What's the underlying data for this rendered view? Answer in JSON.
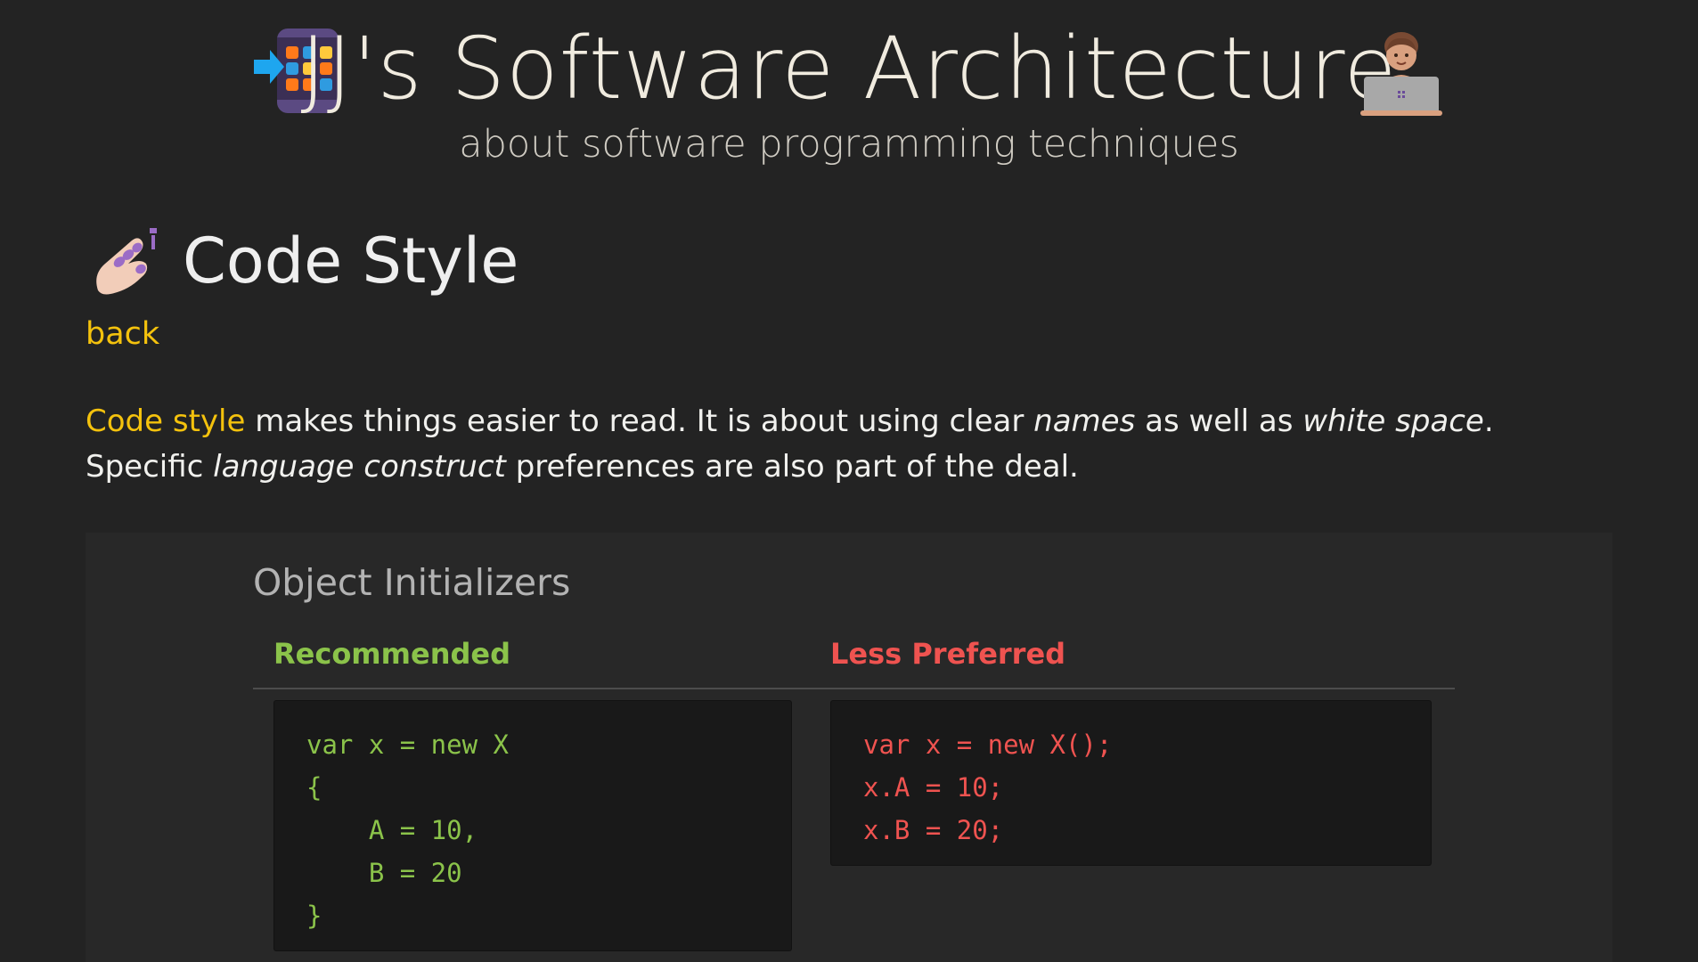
{
  "header": {
    "title": "JJ's Software Architecture",
    "subtitle": "about software programming techniques",
    "logo_icon": "app-grid-enter-icon",
    "developer_icon": "technologist-laptop-icon"
  },
  "article": {
    "section_icon": "nail-polish-icon",
    "title": "Code Style",
    "back_label": "back",
    "intro": {
      "term": "Code style",
      "part1": " makes things easier to read. It is about using clear ",
      "names": "names",
      "part2": " as well as ",
      "white_space": "white space",
      "part3": ".",
      "part4": "Specific ",
      "language_construct": "language construct",
      "part5": " preferences are also part of the deal."
    }
  },
  "sample": {
    "title": "Object Initializers",
    "recommended_label": "Recommended",
    "less_preferred_label": "Less Preferred",
    "recommended_code": "var x = new X\n{\n    A = 10,\n    B = 20\n}",
    "less_preferred_code": "var x = new X();\nx.A = 10;\nx.B = 20;"
  },
  "colors": {
    "background": "#232323",
    "panel": "#282828",
    "code_background": "#191919",
    "accent": "#f4c20d",
    "recommended": "#8bc34a",
    "less_preferred": "#ef5350"
  }
}
